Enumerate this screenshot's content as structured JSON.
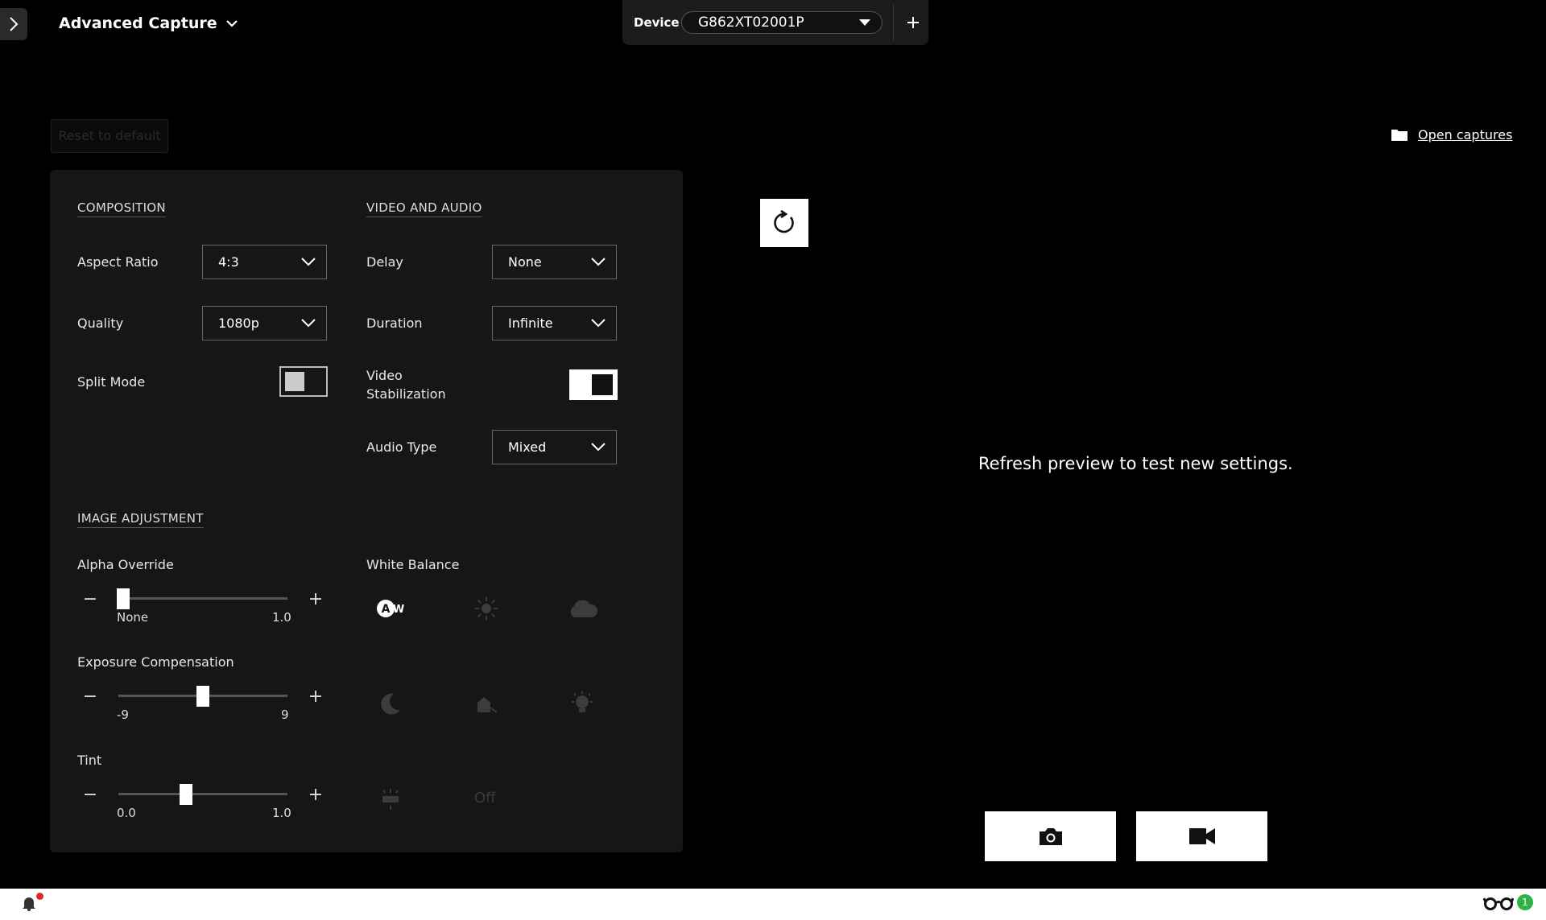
{
  "header": {
    "app_title": "Advanced Capture",
    "device_label": "Device",
    "device_value": "G862XT02001P"
  },
  "toolbar": {
    "reset_label": "Reset to default",
    "open_captures_label": "Open captures"
  },
  "composition": {
    "title": "COMPOSITION",
    "aspect_ratio_label": "Aspect Ratio",
    "aspect_ratio_value": "4:3",
    "quality_label": "Quality",
    "quality_value": "1080p",
    "split_mode_label": "Split Mode",
    "split_mode_on": false
  },
  "video_audio": {
    "title": "VIDEO AND AUDIO",
    "delay_label": "Delay",
    "delay_value": "None",
    "duration_label": "Duration",
    "duration_value": "Infinite",
    "stabilization_label_1": "Video",
    "stabilization_label_2": "Stabilization",
    "stabilization_on": true,
    "audio_type_label": "Audio Type",
    "audio_type_value": "Mixed"
  },
  "image_adjustment": {
    "title": "IMAGE ADJUSTMENT",
    "sliders": [
      {
        "label": "Alpha Override",
        "min_label": "None",
        "max_label": "1.0",
        "position": 0.03
      },
      {
        "label": "Exposure Compensation",
        "min_label": "-9",
        "max_label": "9",
        "position": 0.5
      },
      {
        "label": "Tint",
        "min_label": "0.0",
        "max_label": "1.0",
        "position": 0.4
      }
    ],
    "white_balance_label": "White Balance",
    "white_balance_off_label": "Off",
    "white_balance_selected": "auto-wb-icon"
  },
  "preview": {
    "message": "Refresh preview to test new settings."
  },
  "status": {
    "badge_count": "1"
  },
  "colors": {
    "background": "#000000",
    "panel": "#161616",
    "accent_badge": "#2fb344",
    "notification_dot": "#e0262d"
  }
}
